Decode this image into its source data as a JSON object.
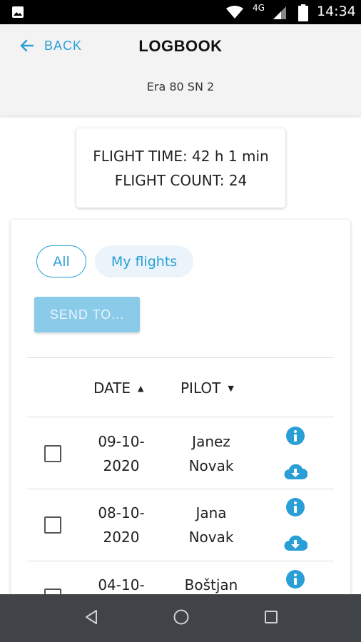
{
  "status_bar": {
    "network": "4G",
    "time": "14:34"
  },
  "header": {
    "back_label": "BACK",
    "title": "LOGBOOK",
    "subtitle": "Era 80 SN 2"
  },
  "summary": {
    "flight_time": "FLIGHT TIME: 42 h 1 min",
    "flight_count": "FLIGHT COUNT: 24"
  },
  "filters": {
    "all": "All",
    "my_flights": "My flights"
  },
  "send_button": "SEND TO...",
  "columns": {
    "date": "DATE",
    "pilot": "PILOT"
  },
  "rows": [
    {
      "date_line1": "09-10-",
      "date_line2": "2020",
      "pilot_line1": "Janez",
      "pilot_line2": "Novak"
    },
    {
      "date_line1": "08-10-",
      "date_line2": "2020",
      "pilot_line1": "Jana",
      "pilot_line2": "Novak"
    },
    {
      "date_line1": "04-10-",
      "date_line2": "",
      "pilot_line1": "Boštjan",
      "pilot_line2": ""
    }
  ],
  "colors": {
    "accent": "#2a9fd6",
    "send_button_disabled": "#8bcbea",
    "header_bg": "#f3f3f4",
    "nav_bg": "#404448"
  }
}
